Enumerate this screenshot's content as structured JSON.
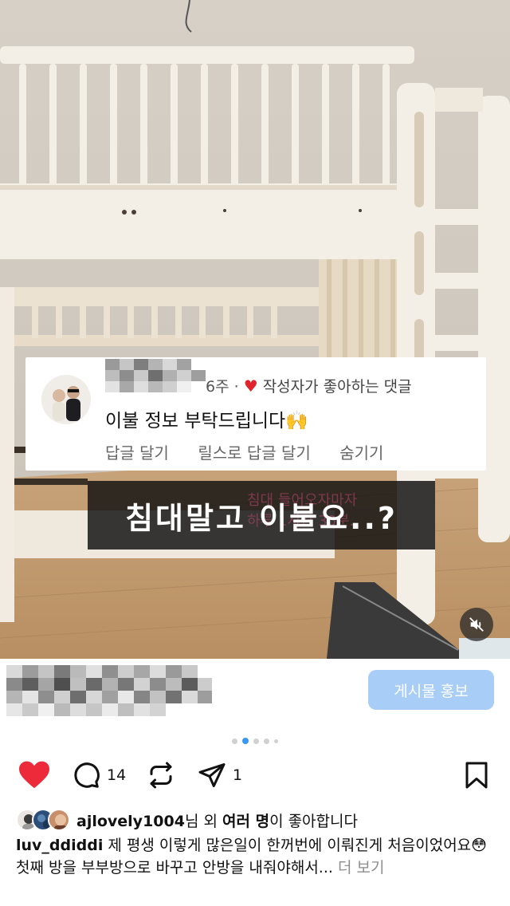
{
  "comment": {
    "time": "6주",
    "liked_label": "작성자가 좋아하는 댓글",
    "text": "이불 정보 부탁드립니다🙌",
    "actions": [
      "답글 달기",
      "릴스로 답글 달기",
      "숨기기"
    ]
  },
  "video_caption": {
    "text": "침대말고 이불요..?",
    "background_text": [
      "침대 들어오자마자",
      "하루 1시간 30분.."
    ]
  },
  "promo": {
    "button_label": "게시물 홍보"
  },
  "carousel": {
    "count": 5,
    "active_index": 1
  },
  "action_bar": {
    "comment_count": "14",
    "share_count": "1"
  },
  "likes": {
    "username": "ajlovely1004",
    "suffix_1": "님 외 ",
    "others": "여러 명",
    "suffix_2": "이 좋아합니다"
  },
  "caption": {
    "username": "luv_ddiddi",
    "line1": " 제 평생 이렇게 많은일이 한꺼번에 이뤄진게 처음이었어요😳",
    "line2": "첫째 방을 부부방으로 바꾸고 안방을 내줘야해서...",
    "more_label": " 더 보기"
  },
  "colors": {
    "heart_red": "#ed2a3a",
    "promo_button": "#a8cdf7",
    "active_dot": "#3897f0"
  },
  "icons": [
    "heart-icon",
    "comment-icon",
    "repost-icon",
    "share-icon",
    "bookmark-icon",
    "mute-icon"
  ]
}
